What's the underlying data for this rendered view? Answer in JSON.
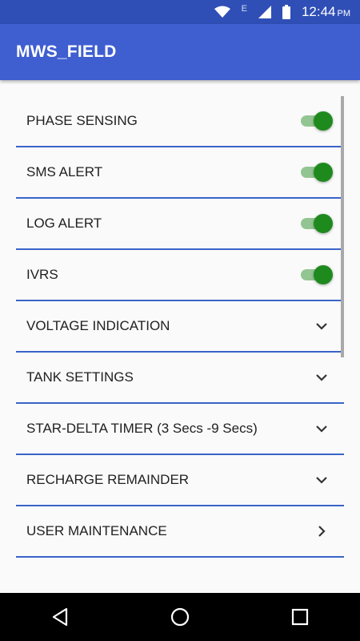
{
  "status_bar": {
    "network_letter": "E",
    "time": "12:44",
    "ampm": "PM",
    "icons": [
      "wifi-icon",
      "signal-icon",
      "battery-icon"
    ]
  },
  "app_bar": {
    "title": "MWS_FIELD"
  },
  "settings": [
    {
      "label": "PHASE SENSING",
      "control": "switch",
      "on": true
    },
    {
      "label": "SMS ALERT",
      "control": "switch",
      "on": true
    },
    {
      "label": "LOG ALERT",
      "control": "switch",
      "on": true
    },
    {
      "label": "IVRS",
      "control": "switch",
      "on": true
    },
    {
      "label": "VOLTAGE INDICATION",
      "control": "expand",
      "icon": "chevron-down-icon"
    },
    {
      "label": "TANK SETTINGS",
      "control": "expand",
      "icon": "chevron-down-icon"
    },
    {
      "label": "STAR-DELTA TIMER (3 Secs -9 Secs)",
      "control": "expand",
      "icon": "chevron-down-icon"
    },
    {
      "label": "RECHARGE REMAINDER",
      "control": "expand",
      "icon": "chevron-down-icon"
    },
    {
      "label": "USER MAINTENANCE",
      "control": "navigate",
      "icon": "chevron-right-icon"
    }
  ],
  "nav_bar": {
    "icons": [
      "back-icon",
      "home-icon",
      "recents-icon"
    ]
  },
  "colors": {
    "status_bar": "#2f4fb6",
    "app_bar": "#3f5ed0",
    "divider": "#3a63c8",
    "switch_thumb": "#1e8a1e",
    "switch_track": "#93c593"
  }
}
